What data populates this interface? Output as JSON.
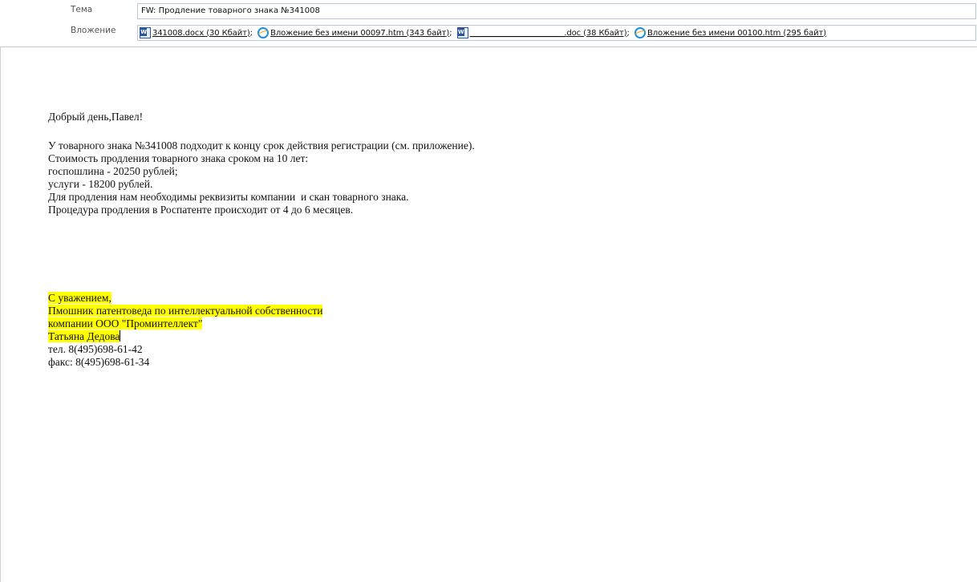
{
  "header": {
    "subject_label": "Тема",
    "subject": "FW: Продление товарного знака №341008",
    "attachment_label": "Вложение",
    "attachments": [
      {
        "name": "341008.docx (30 Кбайт)",
        "icon": "word-doc-icon",
        "sep": ";"
      },
      {
        "name": "Вложение без имени 00097.htm (343 байт)",
        "icon": "ie-htm-icon",
        "sep": ";"
      },
      {
        "name": "________________________.doc (38 Кбайт)",
        "icon": "word-doc-icon",
        "sep": ";"
      },
      {
        "name": "Вложение без имени 00100.htm (295 байт)",
        "icon": "ie-htm-icon",
        "sep": ""
      }
    ]
  },
  "body": {
    "greeting": "Добрый день,Павел!",
    "lines": [
      "У товарного знака №341008 подходит к концу срок действия регистрации (см. приложение).",
      "Стоимость продления товарного знака сроком на 10 лет:",
      "госпошлина - 20250 рублей;",
      "услуги - 18200 рублей.",
      "Для продления нам необходимы реквизиты компании  и скан товарного знака.",
      "Процедура продления в Роспатенте происходит от 4 до 6 месяцев."
    ],
    "signature": {
      "closing": "С уважением,",
      "position": "Пмошник патентоведа по интеллектуальной собственности",
      "company": "компании ООО \"Проминтеллект\"",
      "name": "Татьяна Дедова",
      "phone": "тел. 8(495)698-61-42",
      "fax": "факс: 8(495)698-61-34"
    }
  },
  "colors": {
    "highlight": "#ffff00",
    "field_border": "#b9c9da"
  }
}
